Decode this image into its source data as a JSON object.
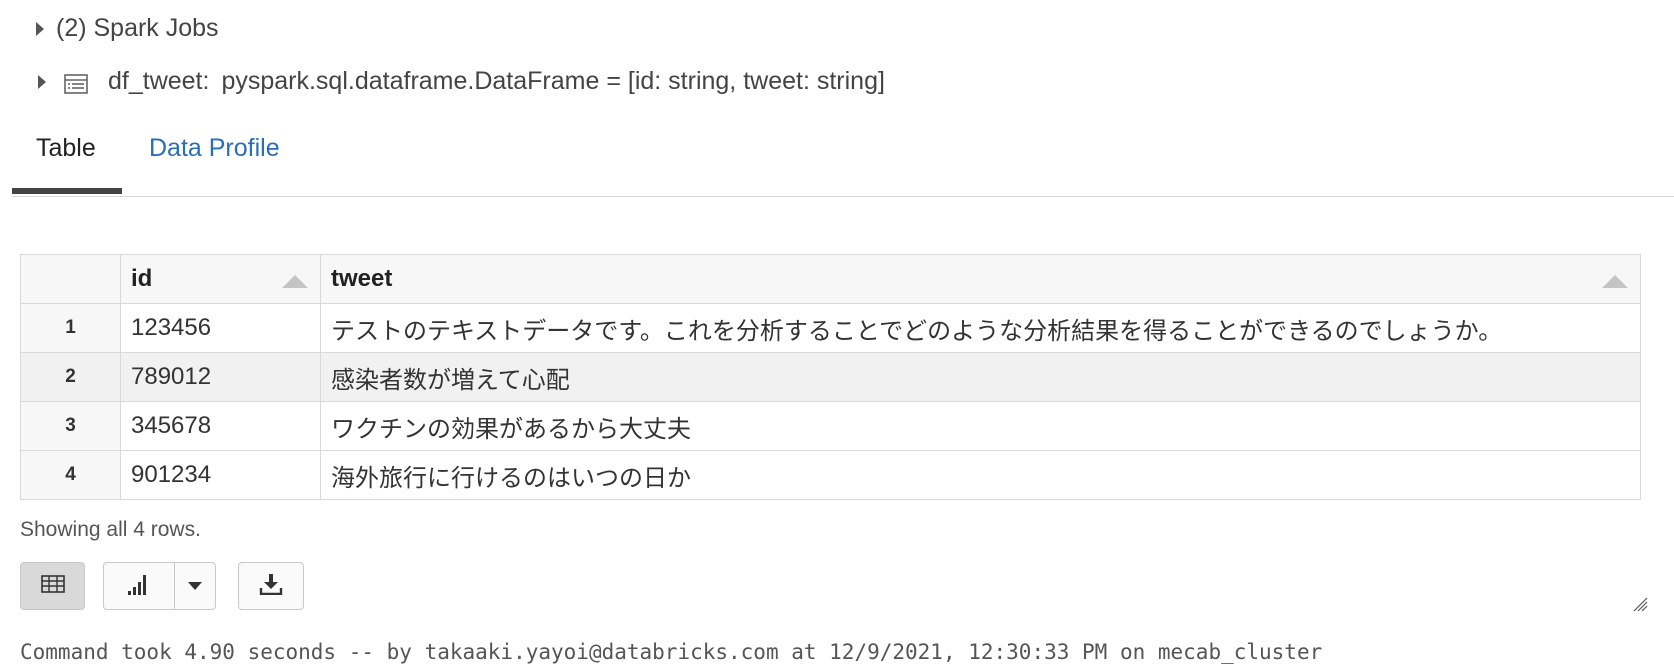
{
  "spark_jobs": {
    "label": "(2) Spark Jobs"
  },
  "schema": {
    "name": "df_tweet:",
    "type": "pyspark.sql.dataframe.DataFrame = [id: string, tweet: string]"
  },
  "tabs": [
    {
      "label": "Table",
      "active": true
    },
    {
      "label": "Data Profile",
      "active": false
    }
  ],
  "table": {
    "columns": [
      "id",
      "tweet"
    ],
    "rows": [
      {
        "index": "1",
        "id": "123456",
        "tweet": "テストのテキストデータです。これを分析することでどのような分析結果を得ることができるのでしょうか。"
      },
      {
        "index": "2",
        "id": "789012",
        "tweet": "感染者数が増えて心配"
      },
      {
        "index": "3",
        "id": "345678",
        "tweet": "ワクチンの効果があるから大丈夫"
      },
      {
        "index": "4",
        "id": "901234",
        "tweet": "海外旅行に行けるのはいつの日か"
      }
    ]
  },
  "status": {
    "showing": "Showing all 4 rows."
  },
  "toolbar": {
    "table_view_icon": "table-icon",
    "chart_icon": "bar-chart-icon",
    "dropdown_icon": "chevron-down-icon",
    "download_icon": "download-icon"
  },
  "command": {
    "text": "Command took 4.90 seconds -- by takaaki.yayoi@databricks.com at 12/9/2021, 12:30:33 PM on mecab_cluster"
  },
  "colors": {
    "link": "#2a6ebb",
    "active_tab_underline": "#444444",
    "alt_row": "#f1f1f1"
  }
}
